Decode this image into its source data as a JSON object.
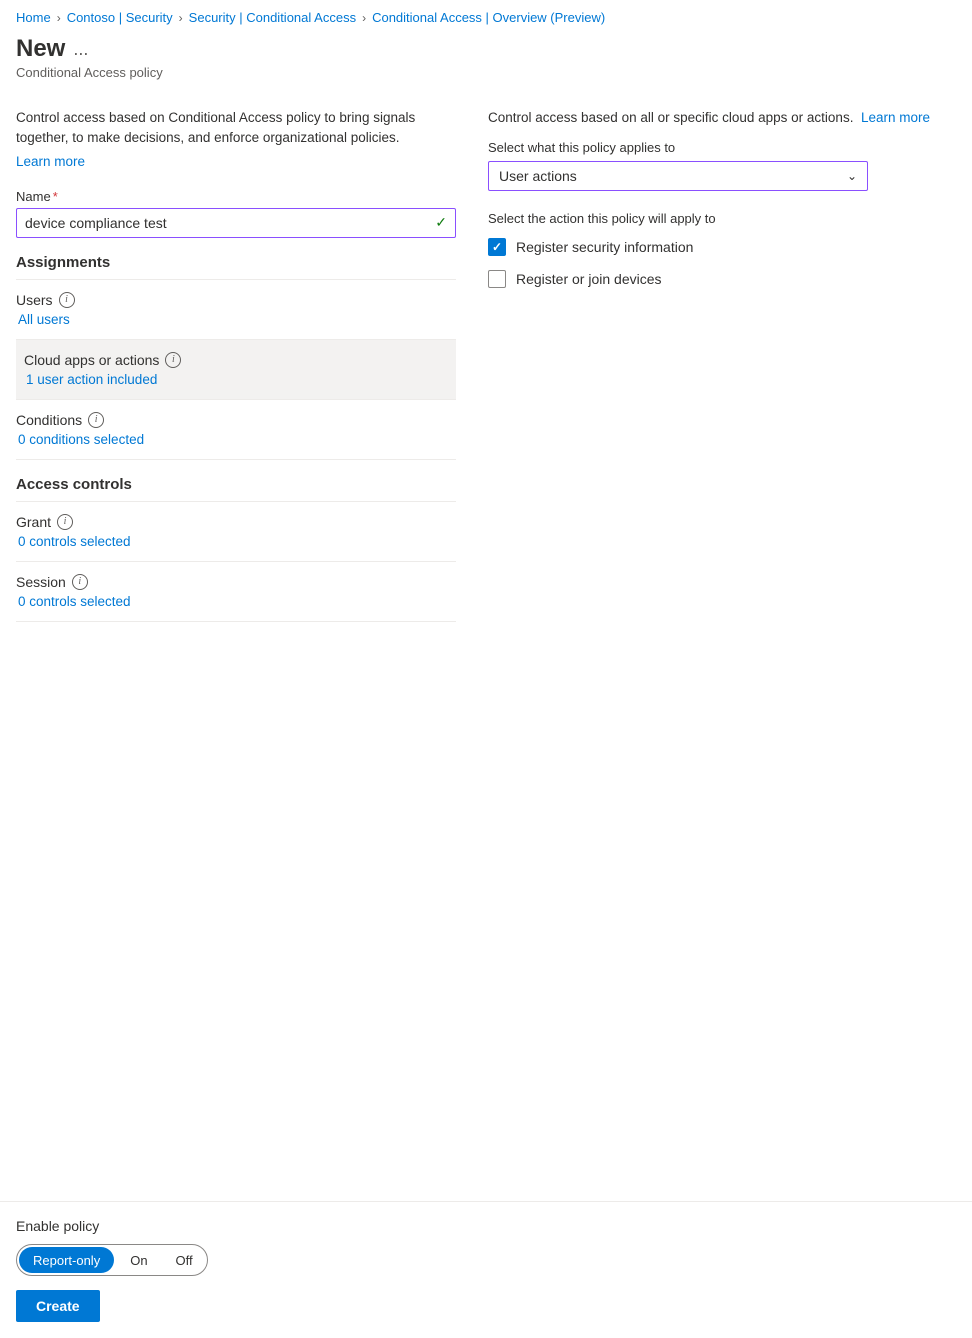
{
  "breadcrumb": {
    "items": [
      {
        "label": "Home",
        "sep": true
      },
      {
        "label": "Contoso | Security",
        "sep": true
      },
      {
        "label": "Security | Conditional Access",
        "sep": true
      },
      {
        "label": "Conditional Access | Overview (Preview)",
        "sep": false
      }
    ]
  },
  "page": {
    "title": "New",
    "ellipsis": "...",
    "subtitle": "Conditional Access policy"
  },
  "left_panel": {
    "description": "Control access based on Conditional Access policy to bring signals together, to make decisions, and enforce organizational policies.",
    "learn_more": "Learn more",
    "name_label": "Name",
    "name_value": "device compliance test",
    "assignments_header": "Assignments",
    "users_label": "Users",
    "users_value": "All users",
    "cloud_apps_label": "Cloud apps or actions",
    "cloud_apps_value": "1 user action included",
    "conditions_label": "Conditions",
    "conditions_value": "0 conditions selected",
    "access_controls_header": "Access controls",
    "grant_label": "Grant",
    "grant_value": "0 controls selected",
    "session_label": "Session",
    "session_value": "0 controls selected"
  },
  "right_panel": {
    "description": "Control access based on all or specific cloud apps or actions.",
    "learn_more": "Learn more",
    "select_label": "Select what this policy applies to",
    "dropdown_value": "User actions",
    "action_label": "Select the action this policy will apply to",
    "checkboxes": [
      {
        "label": "Register security information",
        "checked": true
      },
      {
        "label": "Register or join devices",
        "checked": false
      }
    ]
  },
  "bottom_bar": {
    "enable_label": "Enable policy",
    "toggle_options": [
      {
        "label": "Report-only",
        "active": true
      },
      {
        "label": "On",
        "active": false
      },
      {
        "label": "Off",
        "active": false
      }
    ],
    "create_label": "Create"
  }
}
